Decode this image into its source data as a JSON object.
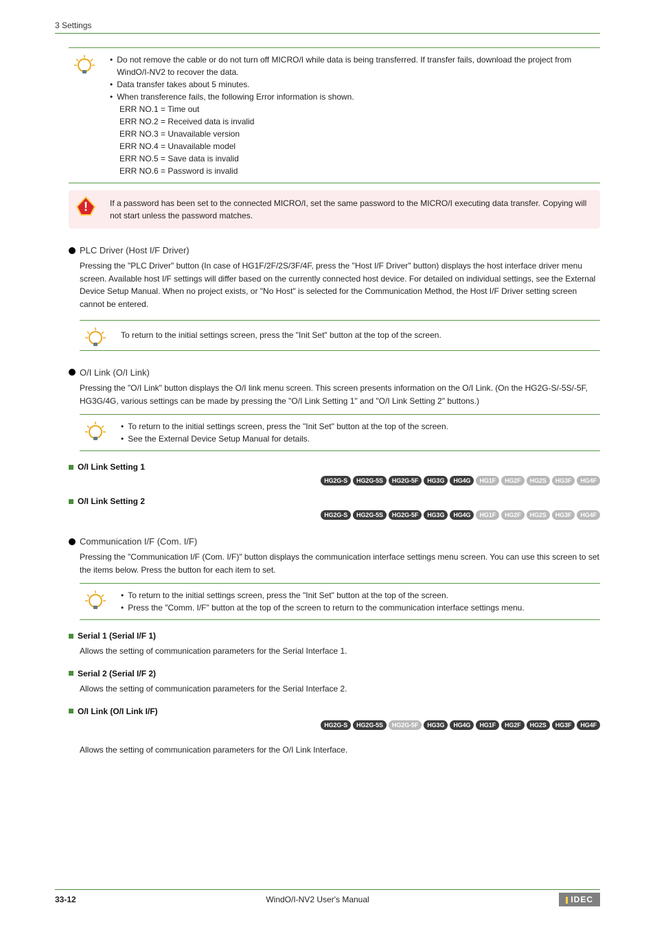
{
  "header": {
    "section": "3 Settings"
  },
  "note1": {
    "b1": "Do not remove the cable or do not turn off MICRO/I while data is being transferred. If transfer fails, download the project from WindO/I-NV2 to recover the data.",
    "b2": "Data transfer takes about 5 minutes.",
    "b3": "When transference fails, the following Error information is shown.",
    "errs": {
      "e1": "ERR NO.1 = Time out",
      "e2": "ERR NO.2 = Received data is invalid",
      "e3": "ERR NO.3 = Unavailable version",
      "e4": "ERR NO.4 = Unavailable model",
      "e5": "ERR NO.5 = Save data is invalid",
      "e6": "ERR NO.6 = Password is invalid"
    }
  },
  "warn1": "If a password has been set to the connected MICRO/I, set the same password to the MICRO/I executing data transfer. Copying will not start unless the password matches.",
  "plc": {
    "title": "PLC Driver (Host I/F Driver)",
    "body": "Pressing the \"PLC Driver\" button (In case of HG1F/2F/2S/3F/4F, press the \"Host I/F Driver\" button) displays the host interface driver menu screen. Available host I/F settings will differ based on the currently connected host device. For detailed on individual settings, see the External Device Setup Manual. When no project exists, or \"No Host\" is selected for the Communication Method, the Host I/F Driver setting screen cannot be entered.",
    "note": "To return to the initial settings screen, press the \"Init Set\" button at the top of the screen."
  },
  "oilink": {
    "title": "O/I Link (O/I Link)",
    "body": "Pressing the \"O/I Link\" button displays the O/I link menu screen. This screen presents information on the O/I Link. (On the HG2G-S/-5S/-5F, HG3G/4G, various settings can be made by pressing the \"O/I Link Setting 1\" and \"O/I Link Setting 2\" buttons.)",
    "noteb1": "To return to the initial settings screen, press the \"Init Set\" button at the top of the screen.",
    "noteb2": "See the External Device Setup Manual for details.",
    "sub1": "O/I Link Setting 1",
    "sub2": "O/I Link Setting 2"
  },
  "comm": {
    "title": "Communication I/F (Com. I/F)",
    "body": "Pressing the \"Communication I/F (Com. I/F)\" button displays the communication interface settings menu screen. You can use this screen to set the items below. Press the button for each item to set.",
    "noteb1": "To return to the initial settings screen, press the \"Init Set\" button at the top of the screen.",
    "noteb2": "Press the \"Comm. I/F\" button at the top of the screen to return to the communication interface settings menu.",
    "serial1_title": "Serial 1 (Serial I/F 1)",
    "serial1_body": "Allows the setting of communication parameters for the Serial Interface 1.",
    "serial2_title": "Serial 2 (Serial I/F 2)",
    "serial2_body": "Allows the setting of communication parameters for the Serial Interface 2.",
    "oilinkif_title": "O/I Link (O/I Link I/F)",
    "oilinkif_body": "Allows the setting of communication parameters for the O/I Link Interface."
  },
  "tags": {
    "common": [
      "HG2G-S",
      "HG2G-5S",
      "HG2G-5F",
      "HG3G",
      "HG4G",
      "HG1F",
      "HG2F",
      "HG2S",
      "HG3F",
      "HG4F"
    ],
    "row_a_active": [
      true,
      true,
      true,
      true,
      true,
      false,
      false,
      false,
      false,
      false
    ],
    "row_c_active": [
      true,
      true,
      false,
      true,
      true,
      true,
      true,
      true,
      true,
      true
    ]
  },
  "footer": {
    "page": "33-12",
    "center": "WindO/I-NV2 User's Manual",
    "logo": "IDEC"
  }
}
